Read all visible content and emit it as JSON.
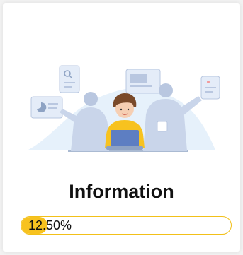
{
  "card": {
    "title": "Information",
    "progress": {
      "label": "12.50%",
      "value_percent": 12.5
    },
    "illustration": {
      "icon": "team-working-illustration",
      "colors": {
        "accent": "#f7c21f",
        "figures": "#b9c7e0",
        "background_shape": "#e6f1fb"
      }
    }
  }
}
